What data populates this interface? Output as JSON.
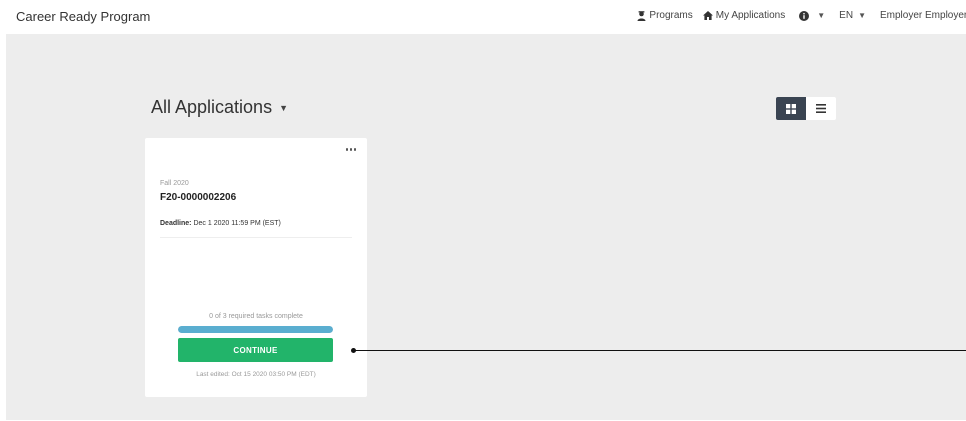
{
  "app": {
    "title": "Career Ready Program"
  },
  "nav": {
    "programs_label": "Programs",
    "my_applications_label": "My Applications",
    "language_label": "EN",
    "user_label": "Employer Employer"
  },
  "page": {
    "heading": "All Applications"
  },
  "view_toggle": {
    "active": "grid"
  },
  "card": {
    "term": "Fall 2020",
    "id": "F20-0000002206",
    "deadline_label": "Deadline:",
    "deadline_value": "Dec 1 2020 11:59 PM (EST)",
    "tasks_status": "0 of 3 required tasks complete",
    "progress_fraction": 1.0,
    "continue_label": "CONTINUE",
    "last_edited": "Last edited: Oct 15 2020 03:50 PM (EDT)"
  },
  "colors": {
    "continue_button": "#22b46a",
    "progress_fill": "#5aaed0",
    "toggle_active": "#3a4452",
    "main_background": "#ededed"
  },
  "icons": {
    "programs": "graduate-icon",
    "my_applications": "home-icon",
    "info": "info-circle-icon",
    "grid_view": "grid-icon",
    "list_view": "list-icon",
    "card_menu": "ellipsis-icon"
  }
}
